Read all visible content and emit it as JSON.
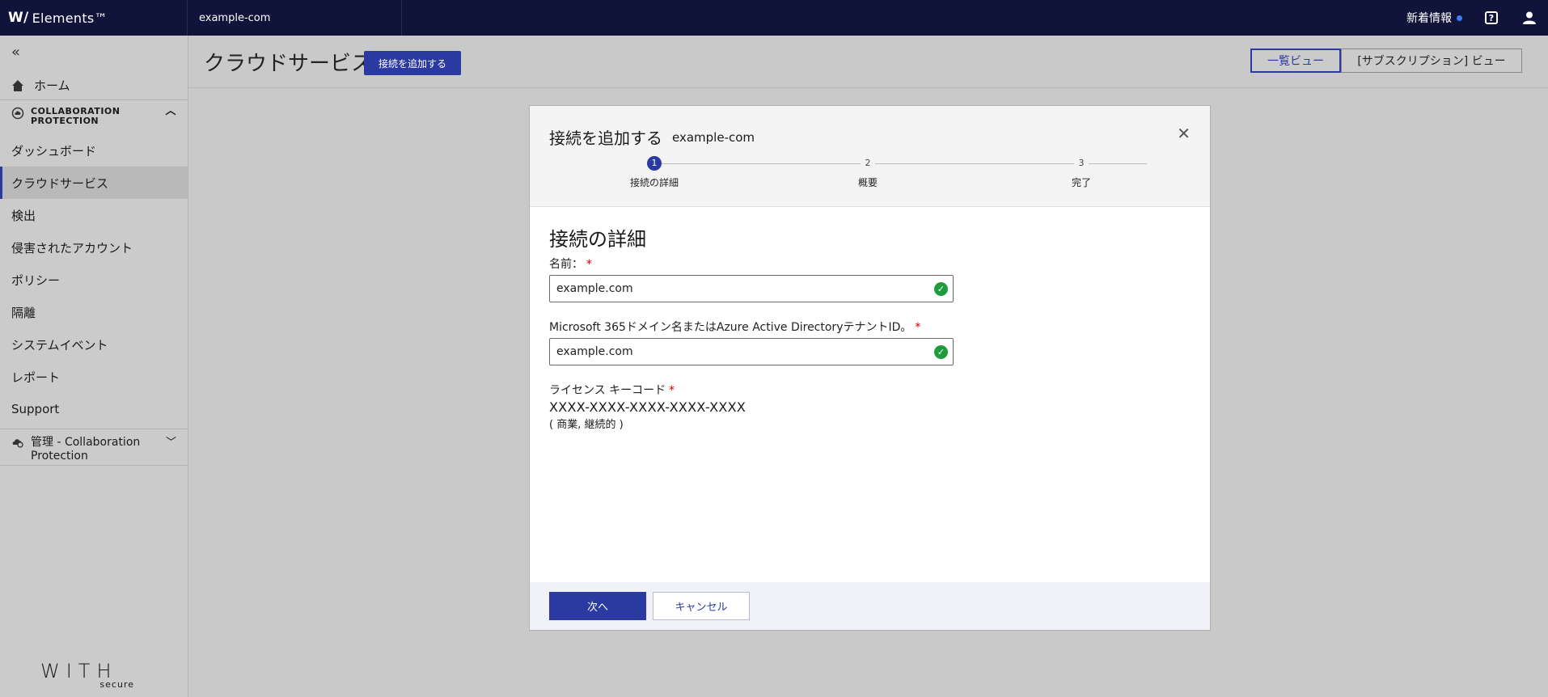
{
  "topbar": {
    "brand": "Elements™",
    "org": "example-com",
    "news": "新着情報",
    "help_symbol": "?",
    "icons": {
      "help": "help-icon",
      "user": "user-icon"
    }
  },
  "sidebar": {
    "collapse_symbol": "«",
    "home": "ホーム",
    "section": {
      "line1": "COLLABORATION",
      "line2": "PROTECTION"
    },
    "items": [
      {
        "label": "ダッシュボード"
      },
      {
        "label": "クラウドサービス"
      },
      {
        "label": "検出"
      },
      {
        "label": "侵害されたアカウント"
      },
      {
        "label": "ポリシー"
      },
      {
        "label": "隔離"
      },
      {
        "label": "システムイベント"
      },
      {
        "label": "レポート"
      },
      {
        "label": "Support"
      }
    ],
    "admin": {
      "line1": "管理 - Collaboration",
      "line2": "Protection"
    },
    "footer_logo": {
      "w": "WITH",
      "s": "secure"
    }
  },
  "main": {
    "title": "クラウドサービス",
    "add_button": "接続を追加する",
    "view_list": "一覧ビュー",
    "view_subscription": "[サブスクリプション] ビュー"
  },
  "modal": {
    "title": "接続を追加する",
    "subtitle": "example-com",
    "close_symbol": "✕",
    "steps": [
      {
        "num": "1",
        "label": "接続の詳細"
      },
      {
        "num": "2",
        "label": "概要"
      },
      {
        "num": "3",
        "label": "完了"
      }
    ],
    "section_title": "接続の詳細",
    "name_label": "名前：",
    "name_value": "example.com",
    "domain_label": "Microsoft 365ドメイン名またはAzure Active DirectoryテナントID。",
    "domain_value": "example.com",
    "license_label": "ライセンス キーコード",
    "license_code": "XXXX-XXXX-XXXX-XXXX-XXXX",
    "license_note": "( 商業, 継続的 )",
    "required_mark": "*",
    "next_button": "次へ",
    "cancel_button": "キャンセル"
  },
  "colors": {
    "accent": "#2b3aa0",
    "topbar": "#10143a",
    "success": "#1f9d3c",
    "required": "#cc0000"
  }
}
